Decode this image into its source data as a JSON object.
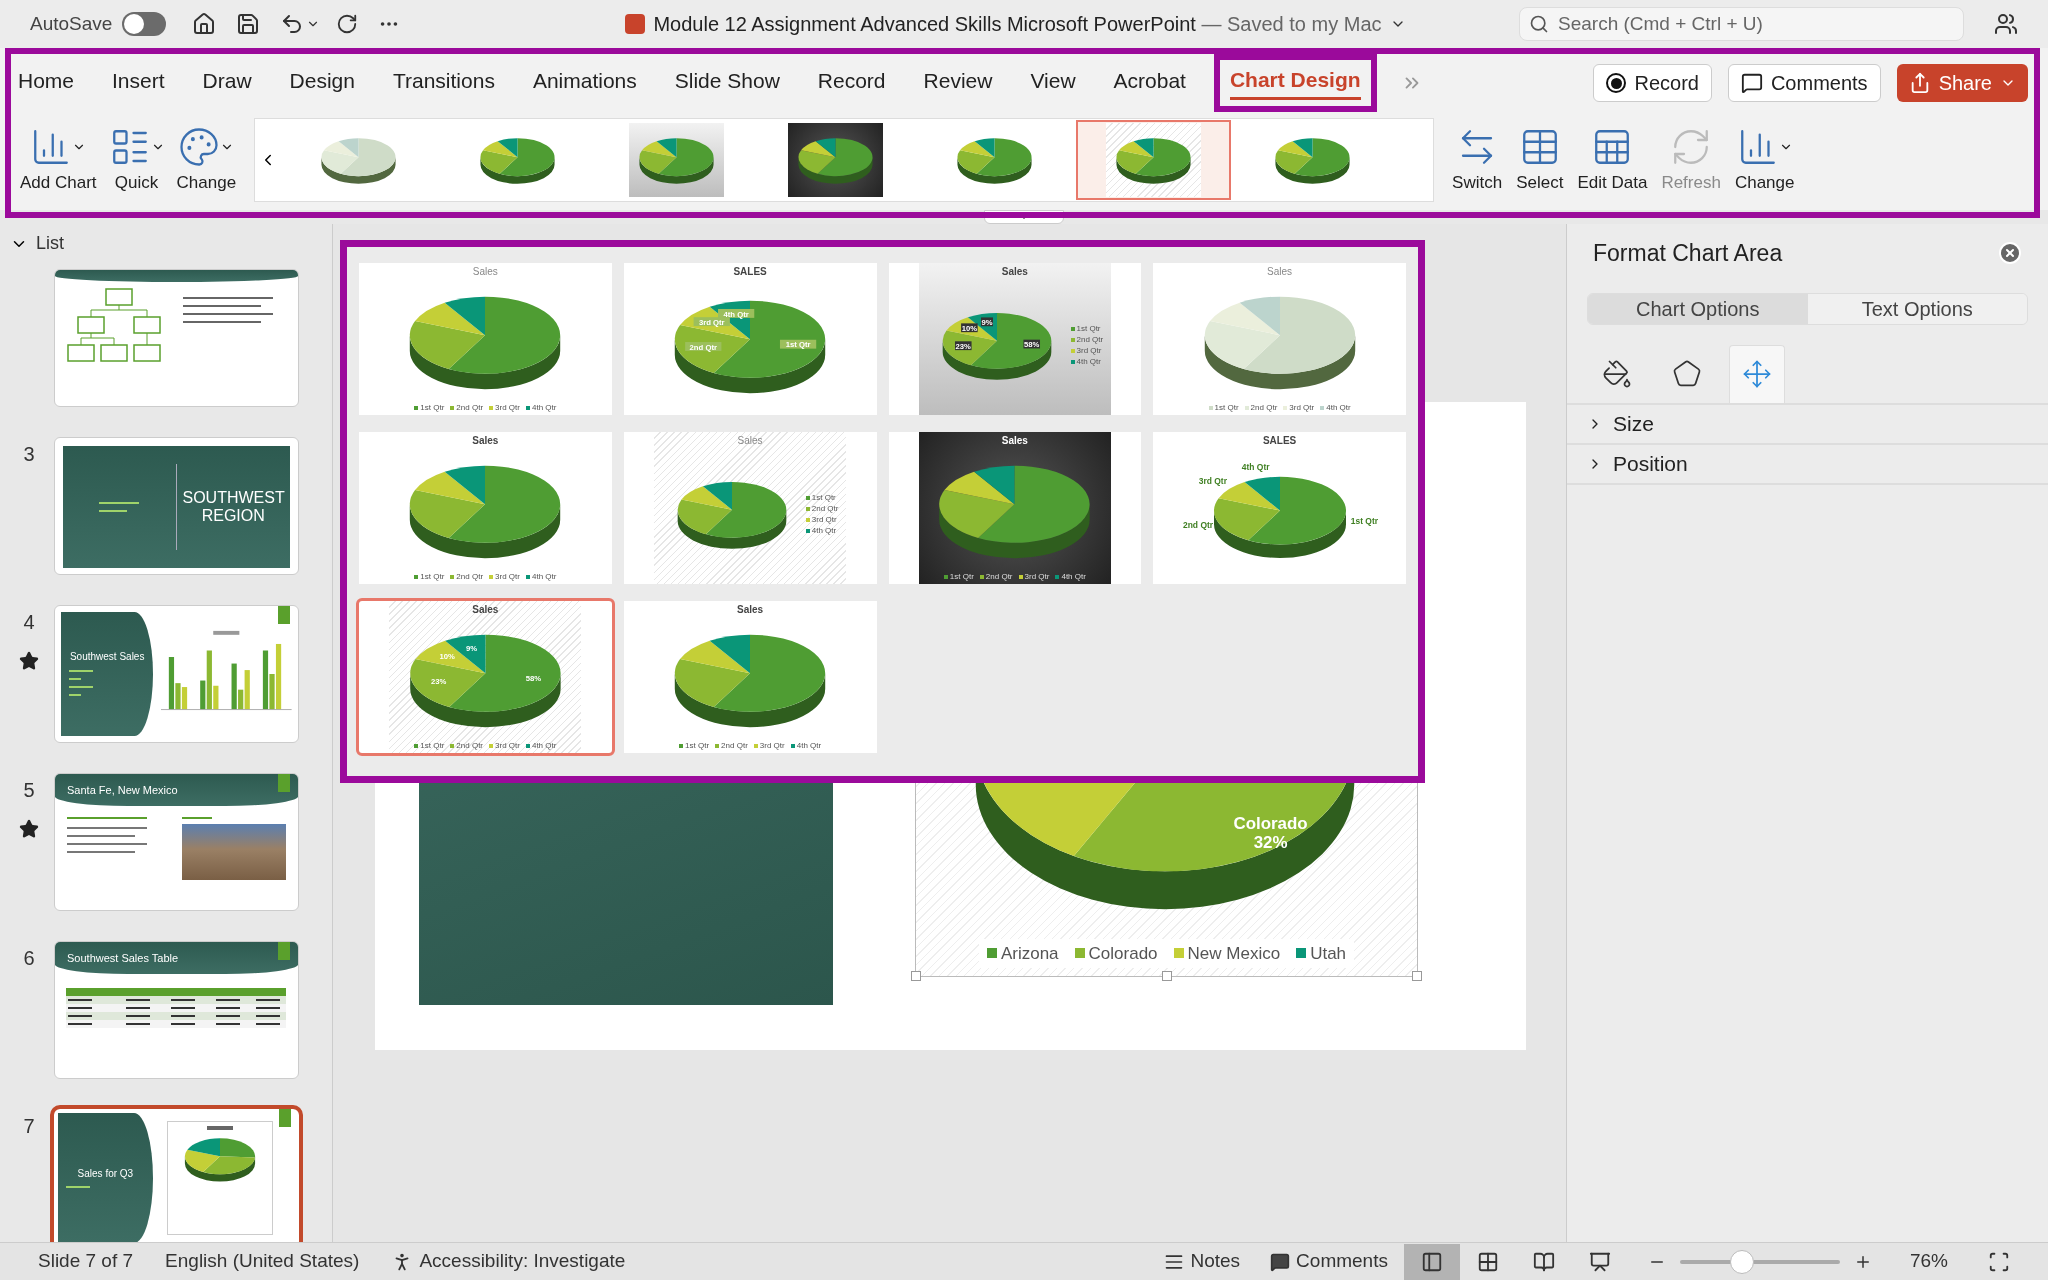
{
  "title_bar": {
    "autosave_label": "AutoSave",
    "autosave_on": false,
    "doc_title": "Module 12 Assignment Advanced Skills Microsoft PowerPoint",
    "save_status": "— Saved to my Mac",
    "search": {
      "placeholder": "Search (Cmd + Ctrl + U)"
    }
  },
  "tabs": [
    {
      "label": "Home",
      "selected": false
    },
    {
      "label": "Insert",
      "selected": false
    },
    {
      "label": "Draw",
      "selected": false
    },
    {
      "label": "Design",
      "selected": false
    },
    {
      "label": "Transitions",
      "selected": false
    },
    {
      "label": "Animations",
      "selected": false
    },
    {
      "label": "Slide Show",
      "selected": false
    },
    {
      "label": "Record",
      "selected": false
    },
    {
      "label": "Review",
      "selected": false
    },
    {
      "label": "View",
      "selected": false
    },
    {
      "label": "Acrobat",
      "selected": false
    },
    {
      "label": "Chart Design",
      "selected": true
    }
  ],
  "header_buttons": [
    {
      "kind": "record",
      "label": "Record"
    },
    {
      "kind": "comments",
      "label": "Comments"
    },
    {
      "kind": "share",
      "label": "Share"
    }
  ],
  "ribbon_left": [
    {
      "kind": "add",
      "label": "Add Chart"
    },
    {
      "kind": "layout",
      "label": "Quick"
    },
    {
      "kind": "colors",
      "label": "Change"
    }
  ],
  "style_strip": [
    {
      "kind": "white",
      "faded": true,
      "selected": false
    },
    {
      "kind": "white",
      "faded": false,
      "selected": false
    },
    {
      "kind": "gray",
      "faded": false,
      "selected": false
    },
    {
      "kind": "dark",
      "faded": false,
      "selected": false
    },
    {
      "kind": "white",
      "faded": false,
      "selected": false
    },
    {
      "kind": "hatched",
      "faded": false,
      "selected": true
    },
    {
      "kind": "white",
      "faded": false,
      "selected": false
    }
  ],
  "ribbon_right": [
    {
      "kind": "switch",
      "label": "Switch",
      "disabled": false
    },
    {
      "kind": "select",
      "label": "Select",
      "disabled": false
    },
    {
      "kind": "excel",
      "label": "Edit Data",
      "disabled": false
    },
    {
      "kind": "refresh",
      "label": "Refresh",
      "disabled": true
    },
    {
      "kind": "type",
      "label": "Change",
      "disabled": false
    }
  ],
  "style_gallery": [
    {
      "title": "Sales",
      "bold": false,
      "kind": "white",
      "faded": false,
      "legend": [
        "1st Qtr",
        "2nd Qtr",
        "3rd Qtr",
        "4th Qtr"
      ],
      "legend_right": false,
      "selected": false
    },
    {
      "title": "SALES",
      "bold": true,
      "kind": "white",
      "faded": false,
      "labels": [
        "1st Qtr",
        "2nd Qtr",
        "3rd Qtr",
        "4th Qtr"
      ],
      "label_box": true,
      "labels_outside": false,
      "selected": false
    },
    {
      "title": "Sales",
      "bold": true,
      "kind": "gray",
      "faded": false,
      "labels": [
        "58%",
        "23%",
        "10%",
        "9%"
      ],
      "label_box": true,
      "labels_outside": false,
      "legend": [
        "1st Qtr",
        "2nd Qtr",
        "3rd Qtr",
        "4th Qtr"
      ],
      "legend_right": true,
      "selected": false
    },
    {
      "title": "Sales",
      "bold": false,
      "kind": "white",
      "faded": true,
      "legend": [
        "1st Qtr",
        "2nd Qtr",
        "3rd Qtr",
        "4th Qtr"
      ],
      "legend_right": false,
      "selected": false
    },
    {
      "title": "Sales",
      "bold": true,
      "kind": "white",
      "faded": false,
      "legend": [
        "1st Qtr",
        "2nd Qtr",
        "3rd Qtr",
        "4th Qtr"
      ],
      "legend_right": false,
      "selected": false
    },
    {
      "title": "Sales",
      "bold": false,
      "kind": "hatched",
      "faded": false,
      "legend": [
        "1st Qtr",
        "2nd Qtr",
        "3rd Qtr",
        "4th Qtr"
      ],
      "legend_right": true,
      "selected": false
    },
    {
      "title": "Sales",
      "bold": true,
      "kind": "dark",
      "faded": false,
      "legend": [
        "1st Qtr",
        "2nd Qtr",
        "3rd Qtr",
        "4th Qtr"
      ],
      "legend_right": false,
      "selected": false
    },
    {
      "title": "SALES",
      "bold": true,
      "kind": "white",
      "faded": false,
      "labels": [
        "1st Qtr",
        "2nd Qtr",
        "3rd Qtr",
        "4th Qtr"
      ],
      "label_box": false,
      "labels_outside": true,
      "selected": false
    },
    {
      "title": "Sales",
      "bold": true,
      "kind": "hatched",
      "faded": false,
      "labels": [
        "58%",
        "23%",
        "10%",
        "9%"
      ],
      "label_box": false,
      "labels_outside": false,
      "legend": [
        "1st Qtr",
        "2nd Qtr",
        "3rd Qtr",
        "4th Qtr"
      ],
      "legend_right": false,
      "selected": true
    },
    {
      "title": "Sales",
      "bold": true,
      "kind": "white",
      "faded": false,
      "legend": [
        "1st Qtr",
        "2nd Qtr",
        "3rd Qtr",
        "4th Qtr"
      ],
      "legend_right": false,
      "selected": false
    }
  ],
  "slide_list": {
    "header": "List",
    "slides": [
      {
        "kind": "org",
        "animated": false,
        "selected": false
      },
      {
        "kind": "section",
        "number": "3",
        "animated": false,
        "selected": false,
        "title": "SOUTHWEST REGION"
      },
      {
        "kind": "bars",
        "number": "4",
        "animated": true,
        "selected": false,
        "title": "Southwest Sales"
      },
      {
        "kind": "photo",
        "number": "5",
        "animated": true,
        "selected": false,
        "title": "Santa Fe, New Mexico"
      },
      {
        "kind": "table",
        "number": "6",
        "animated": false,
        "selected": false,
        "title": "Southwest Sales Table"
      },
      {
        "kind": "pie",
        "number": "7",
        "animated": false,
        "selected": true,
        "title": "Sales for Q3"
      }
    ]
  },
  "slide": {
    "chart_label": {
      "name": "Colorado",
      "value": "32%"
    },
    "legend": [
      {
        "label": "Arizona",
        "color": "#4f9d33"
      },
      {
        "label": "Colorado",
        "color": "#8cb832"
      },
      {
        "label": "New Mexico",
        "color": "#c4cf37"
      },
      {
        "label": "Utah",
        "color": "#0a9678"
      }
    ]
  },
  "format_pane": {
    "title": "Format Chart Area",
    "options": [
      {
        "label": "Chart Options",
        "selected": true
      },
      {
        "label": "Text Options",
        "selected": false
      }
    ],
    "icon_tabs": [
      {
        "kind": "fill",
        "selected": false
      },
      {
        "kind": "effects",
        "selected": false
      },
      {
        "kind": "size",
        "selected": true
      }
    ],
    "sections": [
      {
        "label": "Size",
        "expanded": false
      },
      {
        "label": "Position",
        "expanded": false
      }
    ]
  },
  "status_bar": {
    "slide_count": "Slide 7 of 7",
    "language": "English (United States)",
    "accessibility": "Accessibility: Investigate",
    "notes": "Notes",
    "comments": "Comments",
    "views": [
      {
        "kind": "normal",
        "selected": true
      },
      {
        "kind": "sorter",
        "selected": false
      },
      {
        "kind": "reading",
        "selected": false
      },
      {
        "kind": "show",
        "selected": false
      }
    ],
    "zoom": {
      "level": 0.39,
      "reading": "76%"
    }
  }
}
